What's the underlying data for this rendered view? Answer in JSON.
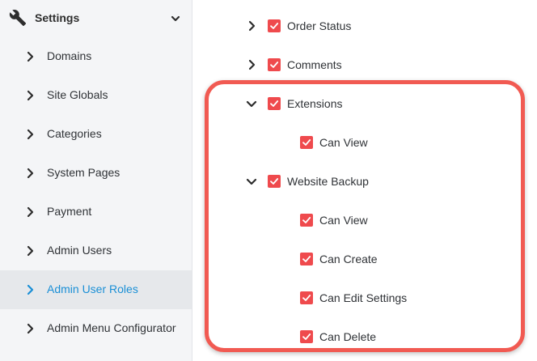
{
  "sidebar": {
    "title": "Settings",
    "header_icon": "wrench-icon",
    "items": [
      {
        "label": "Domains",
        "active": false
      },
      {
        "label": "Site Globals",
        "active": false
      },
      {
        "label": "Categories",
        "active": false
      },
      {
        "label": "System Pages",
        "active": false
      },
      {
        "label": "Payment",
        "active": false
      },
      {
        "label": "Admin Users",
        "active": false
      },
      {
        "label": "Admin User Roles",
        "active": true
      },
      {
        "label": "Admin Menu Configurator",
        "active": false
      }
    ]
  },
  "permissions": {
    "order_status": {
      "label": "Order Status",
      "checked": true,
      "expanded": false
    },
    "comments": {
      "label": "Comments",
      "checked": true,
      "expanded": false
    },
    "extensions": {
      "label": "Extensions",
      "checked": true,
      "expanded": true,
      "children": [
        {
          "label": "Can View",
          "checked": true
        }
      ]
    },
    "website_backup": {
      "label": "Website Backup",
      "checked": true,
      "expanded": true,
      "children": [
        {
          "label": "Can View",
          "checked": true
        },
        {
          "label": "Can Create",
          "checked": true
        },
        {
          "label": "Can Edit Settings",
          "checked": true
        },
        {
          "label": "Can Delete",
          "checked": true
        }
      ]
    }
  },
  "colors": {
    "accent": "#1a8fd6",
    "checkbox": "#ef4a4d",
    "highlight": "#f15a52",
    "sidebar_bg": "#f4f5f7",
    "active_row_bg": "#e6e8eb"
  }
}
